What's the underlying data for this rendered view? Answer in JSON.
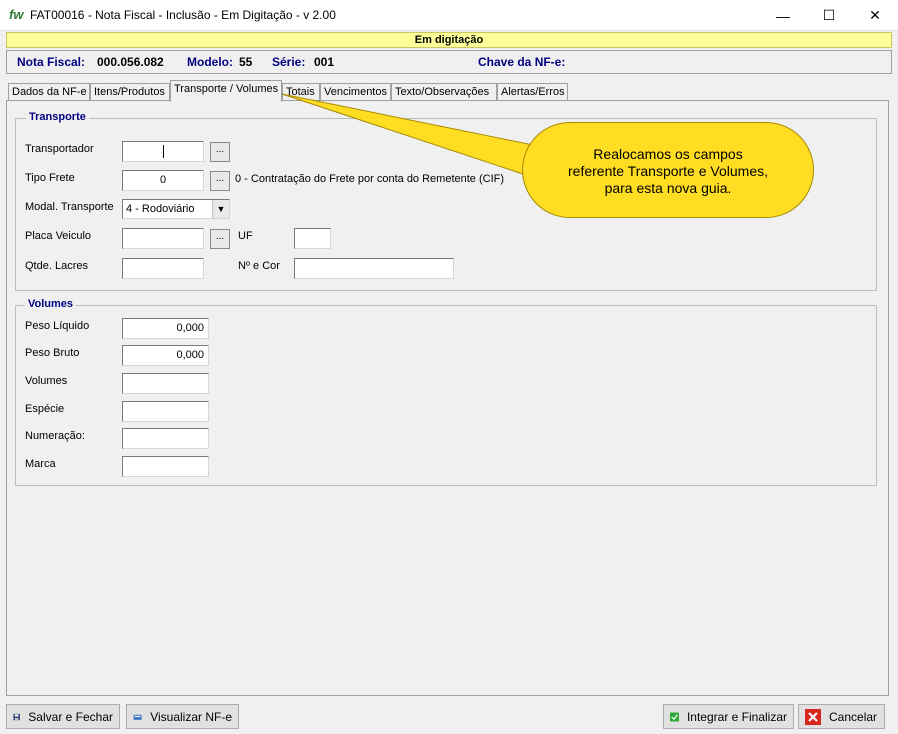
{
  "window": {
    "logo": "fw",
    "title": "FAT00016 - Nota Fiscal - Inclusão - Em Digitação - v 2.00",
    "minimize": "—",
    "maximize": "☐",
    "close": "✕"
  },
  "status": "Em digitação",
  "header": {
    "nf_label": "Nota Fiscal:",
    "nf_value": "000.056.082",
    "modelo_label": "Modelo:",
    "modelo_value": "55",
    "serie_label": "Série:",
    "serie_value": "001",
    "chave_label": "Chave da NF-e:"
  },
  "tabs": [
    {
      "label": "Dados da NF-e"
    },
    {
      "label": "Itens/Produtos"
    },
    {
      "label": "Transporte / Volumes"
    },
    {
      "label": "Totais"
    },
    {
      "label": "Vencimentos"
    },
    {
      "label": "Texto/Observações"
    },
    {
      "label": "Alertas/Erros"
    }
  ],
  "active_tab": "Transporte / Volumes",
  "transporte": {
    "title": "Transporte",
    "transportador_label": "Transportador",
    "transportador_value": "",
    "tipo_frete_label": "Tipo Frete",
    "tipo_frete_value": "0",
    "tipo_frete_desc": "0 - Contratação do Frete por conta do Remetente (CIF)",
    "modal_label": "Modal. Transporte",
    "modal_value": "4 - Rodoviário",
    "placa_label": "Placa Veiculo",
    "placa_value": "",
    "uf_label": "UF",
    "uf_value": "",
    "lacres_label": "Qtde. Lacres",
    "lacres_value": "",
    "cor_label": "Nº e Cor",
    "cor_value": "",
    "lookup_label": "..."
  },
  "volumes": {
    "title": "Volumes",
    "peso_liquido_label": "Peso Líquido",
    "peso_liquido_value": "0,000",
    "peso_bruto_label": "Peso Bruto",
    "peso_bruto_value": "0,000",
    "volumes_label": "Volumes",
    "volumes_value": "",
    "especie_label": "Espécie",
    "especie_value": "",
    "numeracao_label": "Numeração:",
    "numeracao_value": "",
    "marca_label": "Marca",
    "marca_value": ""
  },
  "callout": {
    "line1": "Realocamos os campos",
    "line2": "referente Transporte e Volumes,",
    "line3": "para esta nova guia."
  },
  "buttons": {
    "save": "Salvar e Fechar",
    "view": "Visualizar NF-e",
    "integrate": "Integrar e Finalizar",
    "cancel": "Cancelar"
  },
  "icons": {
    "save": "floppy-disk-icon",
    "view": "nfe-document-icon",
    "integrate": "green-check-icon",
    "cancel": "red-x-icon"
  },
  "colors": {
    "status_bg": "#ffff99",
    "header_labels": "#000080",
    "callout_bg": "#ffdd22",
    "logo": "#2e7d32"
  }
}
